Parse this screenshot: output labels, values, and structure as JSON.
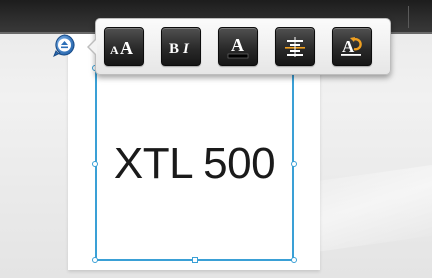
{
  "canvas": {
    "text": "XTL 500"
  },
  "toolbar": {
    "buttons": [
      {
        "name": "font-size",
        "label": "AA"
      },
      {
        "name": "bold-italic",
        "label": "BI"
      },
      {
        "name": "font-color",
        "label": "A"
      },
      {
        "name": "alignment",
        "label": ""
      },
      {
        "name": "reset-format",
        "label": "A"
      }
    ]
  },
  "colors": {
    "selection": "#3aa0d6",
    "toolbar_button": "#2a2a2a",
    "text_color": "#1a1a1a",
    "font_color_underline": "#000000",
    "reset_arrow": "#f0a020",
    "anchor_pin": "#2d6fb7"
  },
  "icons": {
    "anchor": "eject-up-icon",
    "alignment": "vertical-center-align-icon",
    "reset": "undo-format-icon"
  }
}
